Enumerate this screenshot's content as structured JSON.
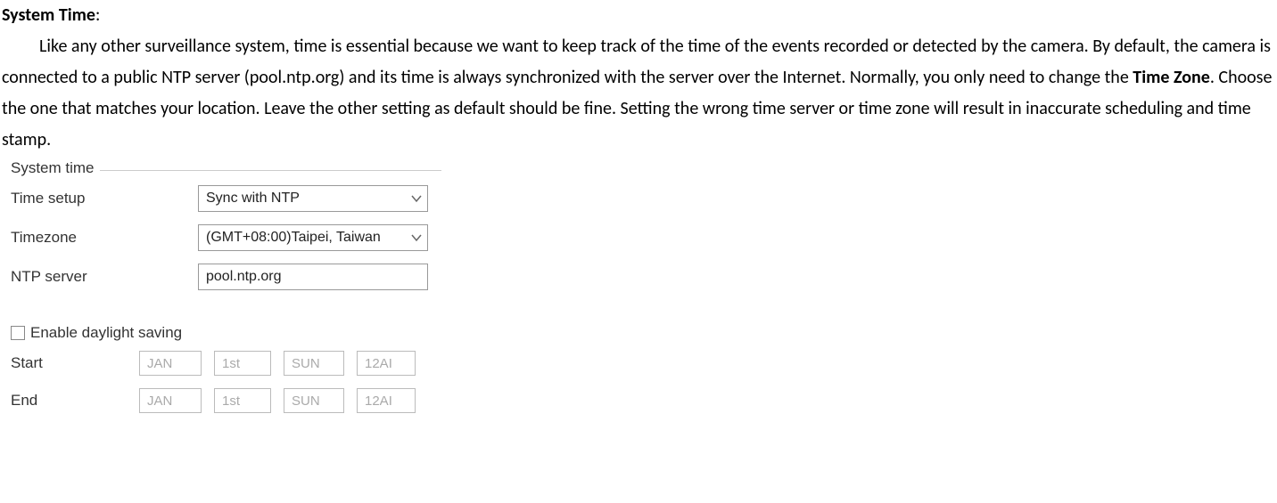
{
  "heading": "System Time",
  "heading_colon": ":",
  "body_parts": {
    "p1": "Like any other surveillance system, time is essential because we want to keep track of the time of the events recorded or detected by the camera. By default, the camera is connected to a public NTP server (pool.ntp.org) and its time is always synchronized with the server over the Internet. Normally, you only need to change the ",
    "tz_bold": "Time Zone",
    "p2": ". Choose the one that matches your location. Leave the other setting as default should be fine. Setting the wrong time server or time zone will result in inaccurate scheduling and time stamp."
  },
  "panel": {
    "legend": "System time",
    "rows": {
      "time_setup_label": "Time setup",
      "time_setup_value": "Sync with NTP",
      "timezone_label": "Timezone",
      "timezone_value": "(GMT+08:00)Taipei, Taiwan",
      "ntp_label": "NTP server",
      "ntp_value": "pool.ntp.org"
    },
    "dst": {
      "checkbox_label": "Enable daylight saving",
      "start_label": "Start",
      "end_label": "End",
      "start": {
        "month": "JAN",
        "ord": "1st",
        "day": "SUN",
        "time": "12AI"
      },
      "end": {
        "month": "JAN",
        "ord": "1st",
        "day": "SUN",
        "time": "12AI"
      }
    }
  }
}
